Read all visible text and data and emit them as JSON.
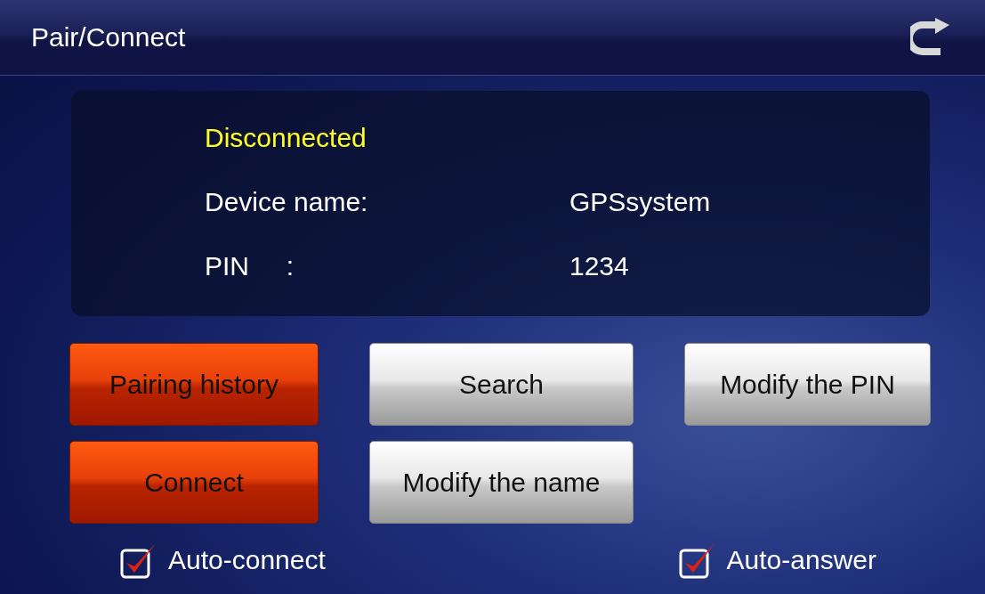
{
  "title": "Pair/Connect",
  "status": "Disconnected",
  "info": [
    {
      "label": "Device name:",
      "value": "GPSsystem"
    },
    {
      "label": "PIN     :",
      "value": "1234"
    }
  ],
  "buttons": [
    {
      "label": "Pairing history",
      "kind": "red"
    },
    {
      "label": "Search",
      "kind": "gray"
    },
    {
      "label": "Modify the PIN",
      "kind": "gray"
    },
    {
      "label": "Connect",
      "kind": "red"
    },
    {
      "label": "Modify the name",
      "kind": "gray"
    }
  ],
  "options": [
    {
      "label": "Auto-connect",
      "checked": true
    },
    {
      "label": "Auto-answer",
      "checked": true
    }
  ]
}
